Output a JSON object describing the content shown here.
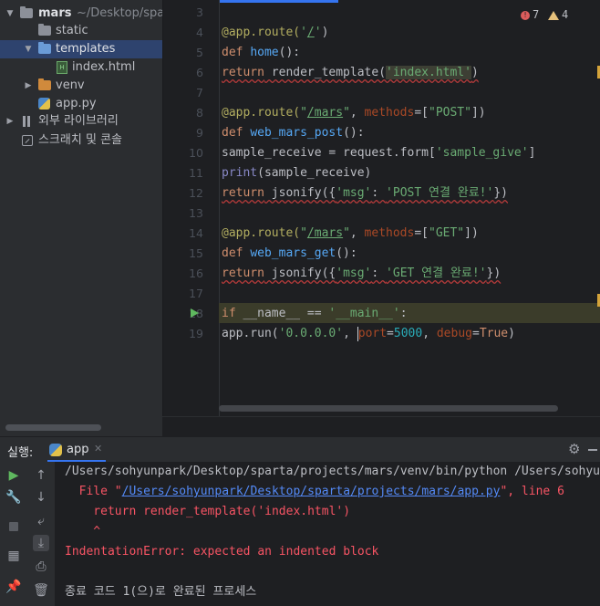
{
  "project_tree": {
    "root": {
      "name": "mars",
      "path": "~/Desktop/sparta/projects/mars"
    },
    "items": [
      {
        "label": "static",
        "type": "folder"
      },
      {
        "label": "templates",
        "type": "folder",
        "selected": true
      },
      {
        "label": "index.html",
        "type": "html-file"
      },
      {
        "label": "venv",
        "type": "folder-excluded"
      },
      {
        "label": "app.py",
        "type": "python-file"
      },
      {
        "label": "외부 라이브러리",
        "type": "libraries"
      },
      {
        "label": "스크래치 및 콘솔",
        "type": "scratches"
      }
    ]
  },
  "editor": {
    "line_numbers": [
      "3",
      "4",
      "5",
      "6",
      "7",
      "8",
      "9",
      "10",
      "11",
      "12",
      "13",
      "14",
      "15",
      "16",
      "17",
      "18",
      "19"
    ],
    "error_count": "7",
    "warning_count": "4",
    "code": {
      "l4": {
        "decorator": "@app.route(",
        "q1": "'",
        "path": "/",
        "q2": "'",
        "close": ")"
      },
      "l5": {
        "kw": "def",
        "name": "home",
        "rest": "():"
      },
      "l6": {
        "kw": "return",
        "call": " render_template(",
        "str": "'index.html'",
        "close": ")"
      },
      "l8": {
        "decorator": "@app.route(",
        "q1": "\"",
        "path": "/mars",
        "q2": "\"",
        "sep": ", ",
        "param": "methods",
        "eq": "=[",
        "str": "\"POST\"",
        "close": "])"
      },
      "l9": {
        "kw": "def",
        "name": "web_mars_post",
        "rest": "():"
      },
      "l10": {
        "text": "sample_receive = request.form[",
        "str": "'sample_give'",
        "close": "]"
      },
      "l11": {
        "builtin": "print",
        "rest": "(sample_receive)"
      },
      "l12": {
        "kw": "return",
        "call": " jsonify({",
        "key": "'msg'",
        "colon": ": ",
        "val": "'POST 연결 완료!'",
        "close": "})"
      },
      "l14": {
        "decorator": "@app.route(",
        "q1": "\"",
        "path": "/mars",
        "q2": "\"",
        "sep": ", ",
        "param": "methods",
        "eq": "=[",
        "str": "\"GET\"",
        "close": "])"
      },
      "l15": {
        "kw": "def",
        "name": "web_mars_get",
        "rest": "():"
      },
      "l16": {
        "kw": "return",
        "call": " jsonify({",
        "key": "'msg'",
        "colon": ": ",
        "val": "'GET 연결 완료!'",
        "close": "})"
      },
      "l18": {
        "kw": "if",
        "text": " __name__ == ",
        "str": "'__main__'",
        "colon": ":"
      },
      "l19": {
        "text": "app.run(",
        "host": "'0.0.0.0'",
        "sep": ", ",
        "param1a": "p",
        "param1b": "ort",
        "eq1": "=",
        "num": "5000",
        "sep2": ", ",
        "param2": "debug",
        "eq2": "=",
        "kwval": "True",
        "close": ")"
      }
    }
  },
  "run": {
    "title": "실행:",
    "tab_label": "app",
    "console": {
      "l1": "/Users/sohyunpark/Desktop/sparta/projects/mars/venv/bin/python /Users/sohyunpark/Desktop/sparta/projects/mars/app.py",
      "l2_prefix": "  File \"",
      "l2_link": "/Users/sohyunpark/Desktop/sparta/projects/mars/app.py",
      "l2_suffix": "\", line 6",
      "l3": "    return render_template('index.html')",
      "l4": "    ^",
      "l5": "IndentationError: expected an indented block",
      "l6": "",
      "l7": "종료 코드 1(으)로 완료된 프로세스"
    }
  }
}
